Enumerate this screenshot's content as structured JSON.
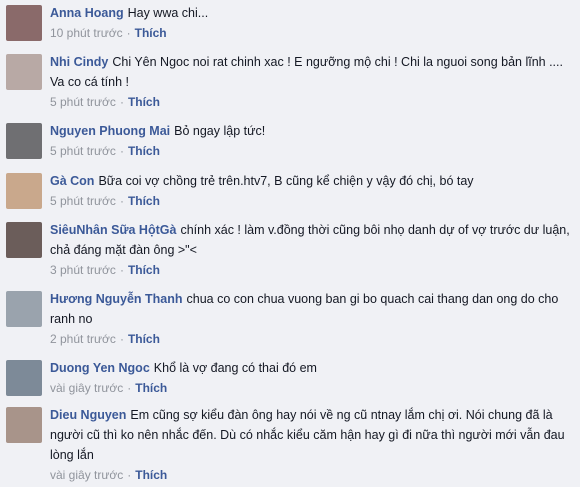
{
  "comments": [
    {
      "author": "Anna Hoang",
      "text": "Hay wwa chi...",
      "time": "10 phút trước",
      "separator": "·",
      "like_label": "Thích",
      "avatar_color": "#8a6a6a"
    },
    {
      "author": "Nhi Cindy",
      "text": "Chi Yên Ngoc noi rat chinh xac ! E ngưỡng mộ chi ! Chi la nguoi song bản lĩnh .... Va co cá tính !",
      "time": "5 phút trước",
      "separator": "·",
      "like_label": "Thích",
      "avatar_color": "#b8a9a5"
    },
    {
      "author": "Nguyen Phuong Mai",
      "text": "Bỏ ngay lập tức!",
      "time": "5 phút trước",
      "separator": "·",
      "like_label": "Thích",
      "avatar_color": "#6f6f72"
    },
    {
      "author": "Gà Con",
      "text": "Bữa coi vợ chồng trẻ trên.htv7, B cũng kể chiện y vậy đó chị, bó tay",
      "time": "5 phút trước",
      "separator": "·",
      "like_label": "Thích",
      "avatar_color": "#c9a88c"
    },
    {
      "author": "SiêuNhân Sữa HộtGà",
      "text": "chính xác ! làm v.đồng thời cũng bôi nhọ danh dự of vợ trước dư luận, chả đáng mặt đàn ông >\"<",
      "time": "3 phút trước",
      "separator": "·",
      "like_label": "Thích",
      "avatar_color": "#6b5d5a"
    },
    {
      "author": "Hương Nguyễn Thanh",
      "text": "chua co con chua vuong ban gi bo quach cai thang dan ong do cho ranh no",
      "time": "2 phút trước",
      "separator": "·",
      "like_label": "Thích",
      "avatar_color": "#9aa3ad"
    },
    {
      "author": "Duong Yen Ngoc",
      "text": "Khổ là vợ đang có thai đó em",
      "time": "vài giây trước",
      "separator": "·",
      "like_label": "Thích",
      "avatar_color": "#7d8a98"
    },
    {
      "author": "Dieu Nguyen",
      "text": "Em cũng sợ kiểu đàn ông hay nói về ng cũ ntnay lắm chị ơi. Nói chung đã là người cũ thì ko nên nhắc đến. Dù có nhắc kiểu căm hận hay gì đi nữa thì người mới vẫn đau lòng lắn",
      "time": "vài giây trước",
      "separator": "·",
      "like_label": "Thích",
      "avatar_color": "#a8948a"
    }
  ]
}
